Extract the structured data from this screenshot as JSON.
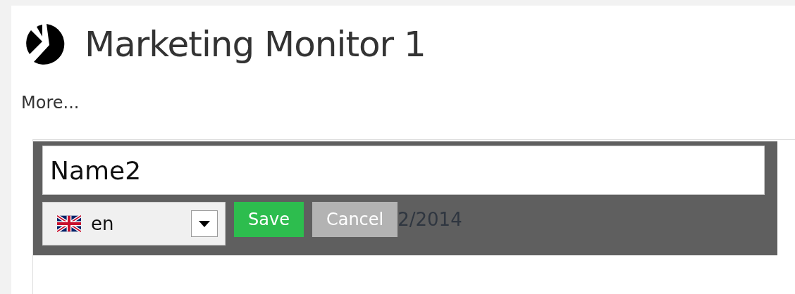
{
  "header": {
    "title": "Marketing Monitor 1",
    "more_link": "More..."
  },
  "editor": {
    "name_value": "Name2",
    "language": "en",
    "date_fragment": "2/2014",
    "buttons": [
      {
        "kind": "save",
        "label": "Save"
      },
      {
        "kind": "cancel",
        "label": "Cancel"
      }
    ]
  }
}
